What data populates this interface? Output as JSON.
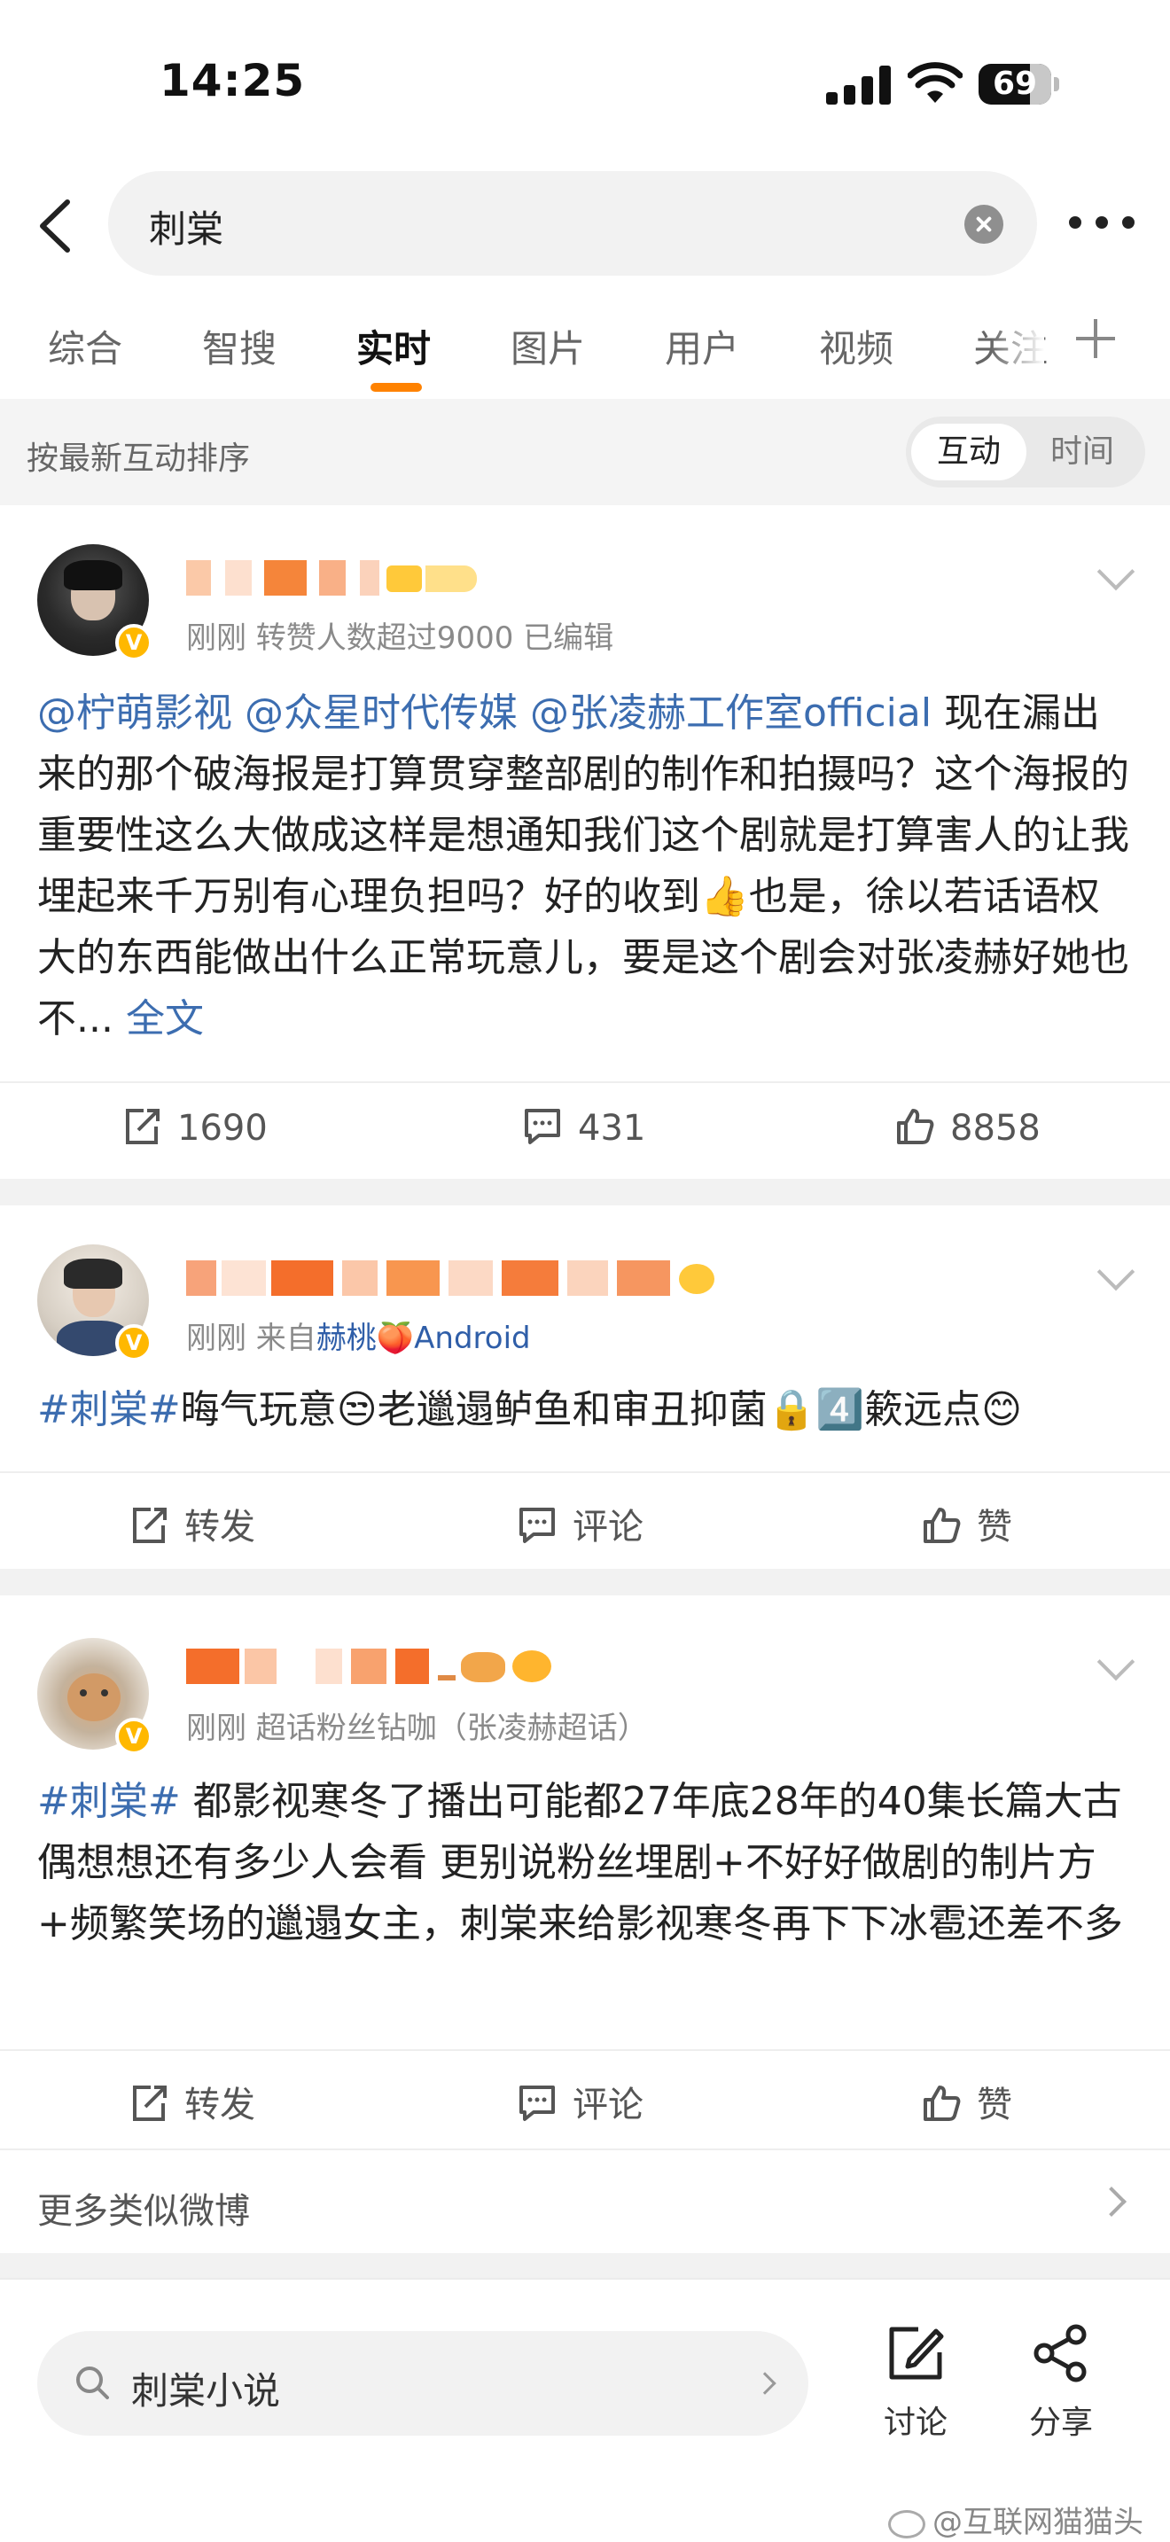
{
  "status_bar": {
    "time": "14:25",
    "battery": "69"
  },
  "search": {
    "query": "刺棠"
  },
  "tabs": [
    {
      "label": "综合"
    },
    {
      "label": "智搜"
    },
    {
      "label": "实时"
    },
    {
      "label": "图片"
    },
    {
      "label": "用户"
    },
    {
      "label": "视频"
    },
    {
      "label": "关注"
    }
  ],
  "sort": {
    "label": "按最新互动排序",
    "options": [
      "互动",
      "时间"
    ],
    "selected": "互动"
  },
  "posts": [
    {
      "meta": "刚刚  转赞人数超过9000    已编辑",
      "mentions": [
        "@柠萌影视",
        "@众星时代传媒",
        "@张凌赫工作室official"
      ],
      "text": "现在漏出来的那个破海报是打算贯穿整部剧的制作和拍摄吗？这个海报的重要性这么大做成这样是想通知我们这个剧就是打算害人的让我埋起来千万别有心理负担吗？好的收到👍也是，徐以若话语权大的东西能做出什么正常玩意儿，要是这个剧会对张凌赫好她也不...",
      "full_text_link": "全文",
      "repost": "1690",
      "comment": "431",
      "like": "8858"
    },
    {
      "meta_prefix": "刚刚  来自",
      "meta_source": "赫桃🍑Android",
      "hashtag": "#刺棠#",
      "text": "晦气玩意😒老邋遢鲈鱼和审丑抑菌🔒4️⃣簌远点😊",
      "repost": "转发",
      "comment": "评论",
      "like": "赞"
    },
    {
      "meta": "刚刚  超话粉丝钻咖（张凌赫超话）",
      "hashtag": "#刺棠#",
      "text": " 都影视寒冬了播出可能都27年底28年的40集长篇大古偶想想还有多少人会看 更别说粉丝埋剧+不好好做剧的制片方+频繁笑场的邋遢女主，刺棠来给影视寒冬再下下冰雹还差不多",
      "repost": "转发",
      "comment": "评论",
      "like": "赞"
    }
  ],
  "more_similar": "更多类似微博",
  "bottom": {
    "search_query": "刺棠小说",
    "discuss": "讨论",
    "share": "分享"
  },
  "watermark": "@互联网猫猫头"
}
